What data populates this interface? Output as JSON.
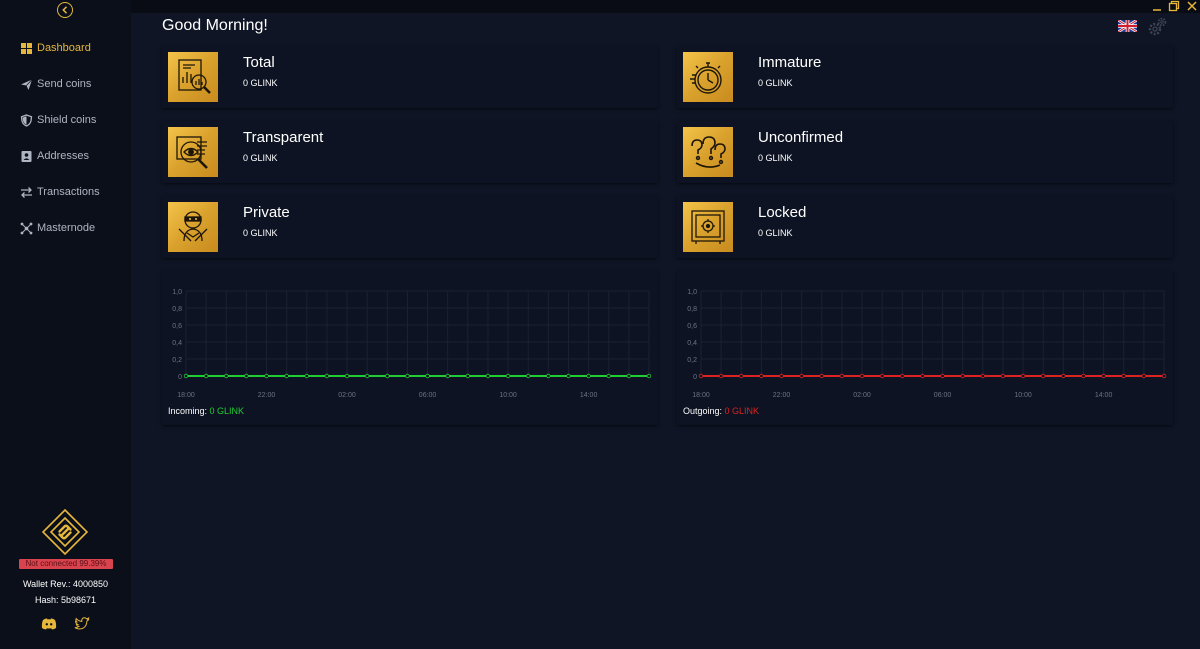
{
  "sidebar": {
    "items": [
      {
        "label": "Dashboard",
        "icon": "grid-icon",
        "active": true
      },
      {
        "label": "Send coins",
        "icon": "paper-plane-icon",
        "active": false
      },
      {
        "label": "Shield coins",
        "icon": "shield-icon",
        "active": false
      },
      {
        "label": "Addresses",
        "icon": "address-book-icon",
        "active": false
      },
      {
        "label": "Transactions",
        "icon": "arrows-exchange-icon",
        "active": false
      },
      {
        "label": "Masternode",
        "icon": "network-icon",
        "active": false
      }
    ],
    "status_badge": "Not connected 99.39%",
    "wallet_rev": "Wallet Rev.: 4000850",
    "hash": "Hash: 5b98671"
  },
  "header": {
    "greeting": "Good Morning!"
  },
  "cards": [
    {
      "title": "Total",
      "value": "0 GLINK",
      "icon": "chart-magnifier-icon"
    },
    {
      "title": "Immature",
      "value": "0 GLINK",
      "icon": "stopwatch-icon"
    },
    {
      "title": "Transparent",
      "value": "0 GLINK",
      "icon": "eye-search-icon"
    },
    {
      "title": "Unconfirmed",
      "value": "0 GLINK",
      "icon": "question-marks-icon"
    },
    {
      "title": "Private",
      "value": "0 GLINK",
      "icon": "ninja-icon"
    },
    {
      "title": "Locked",
      "value": "0 GLINK",
      "icon": "safe-icon"
    }
  ],
  "charts": {
    "incoming": {
      "label": "Incoming:",
      "amount": "0 GLINK"
    },
    "outgoing": {
      "label": "Outgoing:",
      "amount": "0 GLINK"
    }
  },
  "chart_data": [
    {
      "type": "line",
      "x_tick_labels": [
        "18:00",
        "22:00",
        "02:00",
        "06:00",
        "10:00",
        "14:00"
      ],
      "y_tick_labels": [
        "1,0",
        "0,8",
        "0,6",
        "0,4",
        "0,2",
        "0"
      ],
      "ylim": [
        0,
        1
      ],
      "points": 24,
      "series": [
        {
          "values": [
            0,
            0,
            0,
            0,
            0,
            0,
            0,
            0,
            0,
            0,
            0,
            0,
            0,
            0,
            0,
            0,
            0,
            0,
            0,
            0,
            0,
            0,
            0,
            0
          ],
          "color": "#22cc33"
        }
      ]
    },
    {
      "type": "line",
      "x_tick_labels": [
        "18:00",
        "22:00",
        "02:00",
        "06:00",
        "10:00",
        "14:00"
      ],
      "y_tick_labels": [
        "1,0",
        "0,8",
        "0,6",
        "0,4",
        "0,2",
        "0"
      ],
      "ylim": [
        0,
        1
      ],
      "points": 24,
      "series": [
        {
          "values": [
            0,
            0,
            0,
            0,
            0,
            0,
            0,
            0,
            0,
            0,
            0,
            0,
            0,
            0,
            0,
            0,
            0,
            0,
            0,
            0,
            0,
            0,
            0,
            0
          ],
          "color": "#dd2222"
        }
      ]
    }
  ],
  "colors": {
    "accent": "#e5b73b",
    "incoming": "#22cc33",
    "outgoing": "#dd2222",
    "background": "#0f1525",
    "sidebar": "#0b0f1a",
    "card": "#0d1322"
  }
}
